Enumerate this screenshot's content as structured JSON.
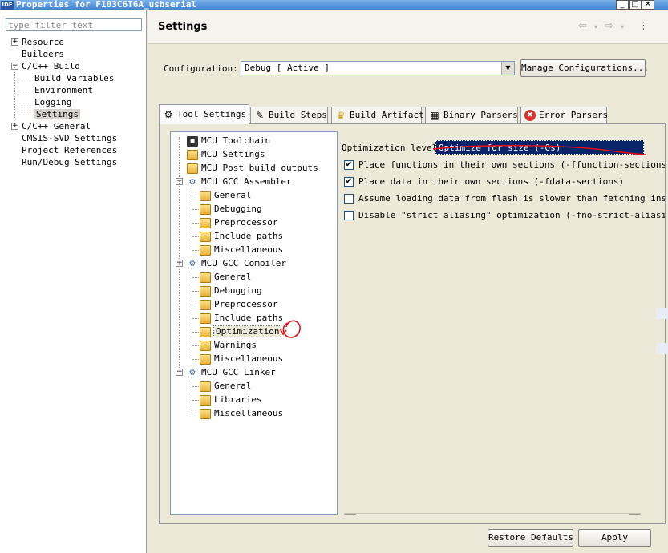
{
  "window": {
    "app_icon_text": "IDE",
    "title": "Properties for F103C6T6A_usbserial",
    "minimize": "_",
    "maximize": "□",
    "close": "✕"
  },
  "left": {
    "filter_placeholder": "type filter text",
    "items": [
      {
        "label": "Resource",
        "expander": "+"
      },
      {
        "label": "Builders",
        "expander": ""
      },
      {
        "label": "C/C++ Build",
        "expander": "−"
      },
      {
        "label": "Build Variables",
        "expander": ""
      },
      {
        "label": "Environment",
        "expander": ""
      },
      {
        "label": "Logging",
        "expander": ""
      },
      {
        "label": "Settings",
        "expander": ""
      },
      {
        "label": "C/C++ General",
        "expander": "+"
      },
      {
        "label": "CMSIS-SVD Settings",
        "expander": ""
      },
      {
        "label": "Project References",
        "expander": ""
      },
      {
        "label": "Run/Debug Settings",
        "expander": ""
      }
    ]
  },
  "header": {
    "title": "Settings",
    "back_icon": "⇦",
    "forward_icon": "⇨",
    "menu_icon": "⋮"
  },
  "config": {
    "label": "Configuration:",
    "value": "Debug  [ Active ]",
    "manage_button": "Manage Configurations..."
  },
  "tabs": [
    {
      "label": "Tool Settings",
      "icon": "⚙"
    },
    {
      "label": "Build Steps",
      "icon": "✎"
    },
    {
      "label": "Build Artifact",
      "icon": "♛"
    },
    {
      "label": "Binary Parsers",
      "icon": "▦"
    },
    {
      "label": "Error Parsers",
      "icon": "✖"
    }
  ],
  "tool_tree": [
    {
      "label": "MCU Toolchain",
      "icon": "chip"
    },
    {
      "label": "MCU Settings",
      "icon": "folder"
    },
    {
      "label": "MCU Post build outputs",
      "icon": "folder"
    },
    {
      "label": "MCU GCC Assembler",
      "icon": "gear",
      "expander": "−"
    },
    {
      "label": "General",
      "icon": "folder"
    },
    {
      "label": "Debugging",
      "icon": "folder"
    },
    {
      "label": "Preprocessor",
      "icon": "folder"
    },
    {
      "label": "Include paths",
      "icon": "folder"
    },
    {
      "label": "Miscellaneous",
      "icon": "folder"
    },
    {
      "label": "MCU GCC Compiler",
      "icon": "gear",
      "expander": "−"
    },
    {
      "label": "General",
      "icon": "folder"
    },
    {
      "label": "Debugging",
      "icon": "folder"
    },
    {
      "label": "Preprocessor",
      "icon": "folder"
    },
    {
      "label": "Include paths",
      "icon": "folder"
    },
    {
      "label": "Optimization",
      "icon": "folder",
      "selected": true
    },
    {
      "label": "Warnings",
      "icon": "folder"
    },
    {
      "label": "Miscellaneous",
      "icon": "folder"
    },
    {
      "label": "MCU GCC Linker",
      "icon": "gear",
      "expander": "−"
    },
    {
      "label": "General",
      "icon": "folder"
    },
    {
      "label": "Libraries",
      "icon": "folder"
    },
    {
      "label": "Miscellaneous",
      "icon": "folder"
    }
  ],
  "options": {
    "level_label": "Optimization level",
    "level_value": "Optimize for size (-Os)",
    "checkboxes": [
      {
        "label": "Place functions in their own sections (-ffunction-sections)",
        "checked": true
      },
      {
        "label": "Place data in their own sections (-fdata-sections)",
        "checked": true
      },
      {
        "label": "Assume loading data from flash is slower than fetching inst",
        "checked": false
      },
      {
        "label": "Disable \"strict aliasing\" optimization (-fno-strict-aliasir",
        "checked": false
      }
    ]
  },
  "footer": {
    "restore_defaults": "Restore Defaults",
    "apply": "Apply"
  },
  "annotation_color": "#e0101a"
}
